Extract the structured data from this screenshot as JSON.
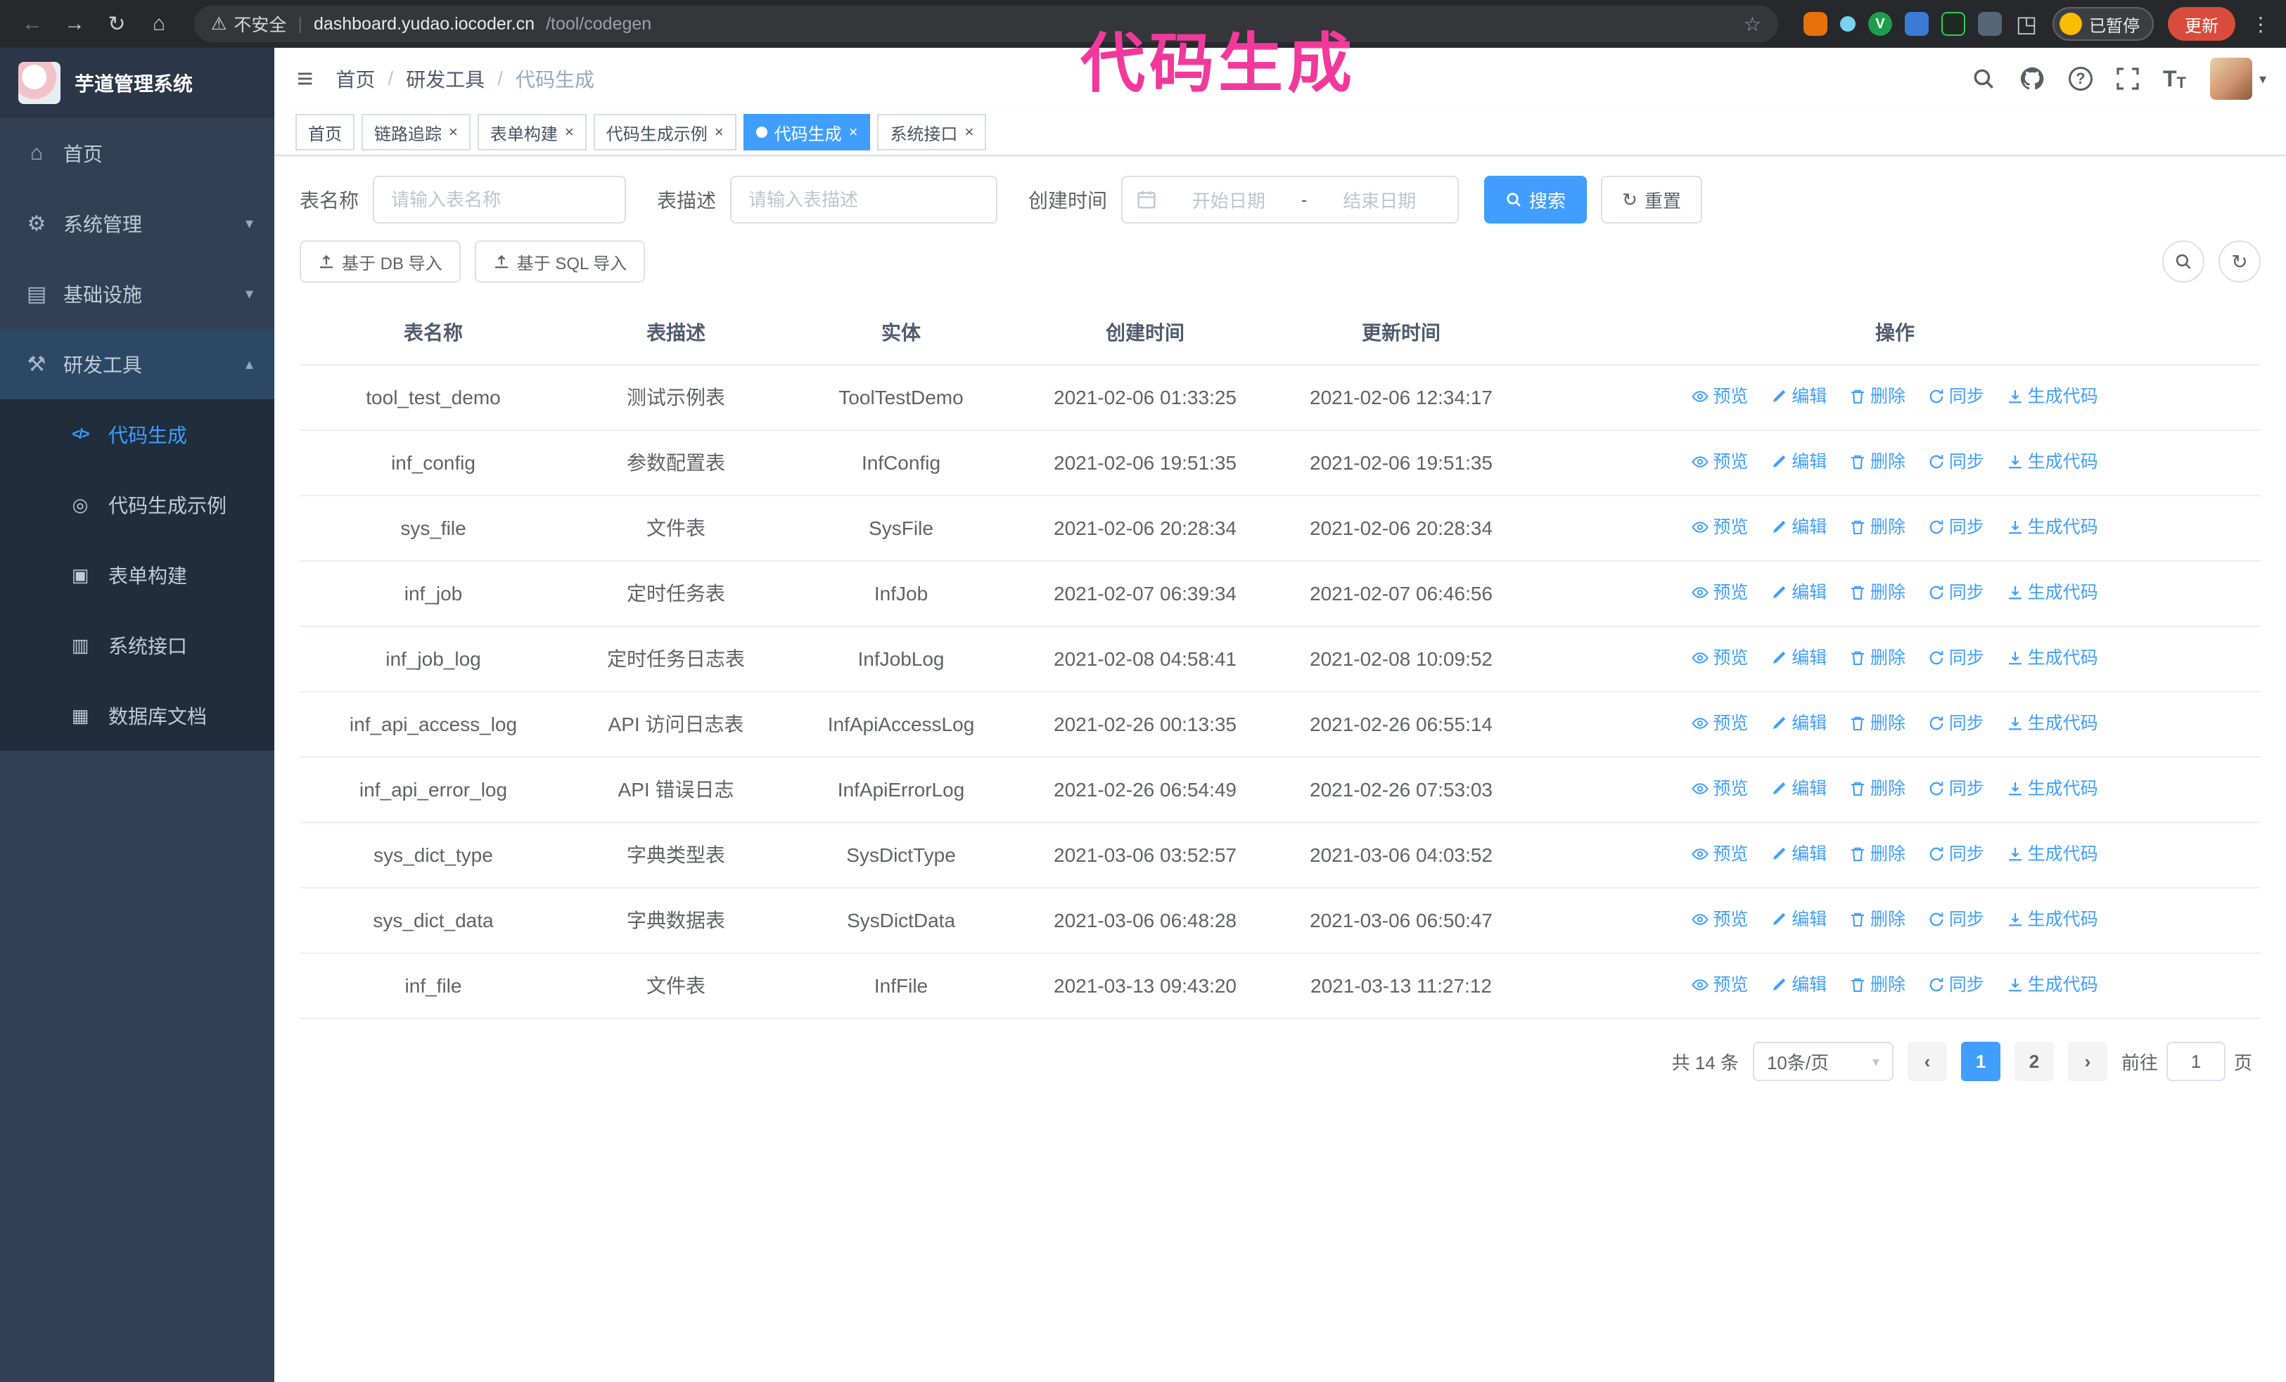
{
  "browser": {
    "security_warning": "不安全",
    "url_domain": "dashboard.yudao.iocoder.cn",
    "url_path": "/tool/codegen",
    "paused_badge": "已暂停",
    "update_button": "更新",
    "ext_v": "V"
  },
  "annotation": {
    "text": "代码生成"
  },
  "app": {
    "title": "芋道管理系统"
  },
  "sidebar": {
    "items": [
      {
        "label": "首页"
      },
      {
        "label": "系统管理"
      },
      {
        "label": "基础设施"
      },
      {
        "label": "研发工具"
      }
    ],
    "sub_items": [
      {
        "label": "代码生成",
        "active": true
      },
      {
        "label": "代码生成示例"
      },
      {
        "label": "表单构建"
      },
      {
        "label": "系统接口"
      },
      {
        "label": "数据库文档"
      }
    ]
  },
  "header": {
    "breadcrumb": [
      "首页",
      "研发工具",
      "代码生成"
    ]
  },
  "tabs": [
    {
      "label": "首页",
      "closable": false
    },
    {
      "label": "链路追踪",
      "closable": true
    },
    {
      "label": "表单构建",
      "closable": true
    },
    {
      "label": "代码生成示例",
      "closable": true
    },
    {
      "label": "代码生成",
      "closable": true,
      "active": true
    },
    {
      "label": "系统接口",
      "closable": true
    }
  ],
  "filters": {
    "table_name_label": "表名称",
    "table_name_placeholder": "请输入表名称",
    "table_desc_label": "表描述",
    "table_desc_placeholder": "请输入表描述",
    "create_time_label": "创建时间",
    "date_start_placeholder": "开始日期",
    "date_separator": "-",
    "date_end_placeholder": "结束日期",
    "search_button": "搜索",
    "reset_button": "重置"
  },
  "toolbar": {
    "import_db": "基于 DB 导入",
    "import_sql": "基于 SQL 导入"
  },
  "table": {
    "columns": [
      "表名称",
      "表描述",
      "实体",
      "创建时间",
      "更新时间",
      "操作"
    ],
    "actions": [
      "预览",
      "编辑",
      "删除",
      "同步",
      "生成代码"
    ],
    "rows": [
      {
        "name": "tool_test_demo",
        "desc": "测试示例表",
        "entity": "ToolTestDemo",
        "created": "2021-02-06 01:33:25",
        "updated": "2021-02-06 12:34:17"
      },
      {
        "name": "inf_config",
        "desc": "参数配置表",
        "entity": "InfConfig",
        "created": "2021-02-06 19:51:35",
        "updated": "2021-02-06 19:51:35"
      },
      {
        "name": "sys_file",
        "desc": "文件表",
        "entity": "SysFile",
        "created": "2021-02-06 20:28:34",
        "updated": "2021-02-06 20:28:34"
      },
      {
        "name": "inf_job",
        "desc": "定时任务表",
        "entity": "InfJob",
        "created": "2021-02-07 06:39:34",
        "updated": "2021-02-07 06:46:56"
      },
      {
        "name": "inf_job_log",
        "desc": "定时任务日志表",
        "entity": "InfJobLog",
        "created": "2021-02-08 04:58:41",
        "updated": "2021-02-08 10:09:52"
      },
      {
        "name": "inf_api_access_log",
        "desc": "API 访问日志表",
        "entity": "InfApiAccessLog",
        "created": "2021-02-26 00:13:35",
        "updated": "2021-02-26 06:55:14"
      },
      {
        "name": "inf_api_error_log",
        "desc": "API 错误日志",
        "entity": "InfApiErrorLog",
        "created": "2021-02-26 06:54:49",
        "updated": "2021-02-26 07:53:03"
      },
      {
        "name": "sys_dict_type",
        "desc": "字典类型表",
        "entity": "SysDictType",
        "created": "2021-03-06 03:52:57",
        "updated": "2021-03-06 04:03:52"
      },
      {
        "name": "sys_dict_data",
        "desc": "字典数据表",
        "entity": "SysDictData",
        "created": "2021-03-06 06:48:28",
        "updated": "2021-03-06 06:50:47"
      },
      {
        "name": "inf_file",
        "desc": "文件表",
        "entity": "InfFile",
        "created": "2021-03-13 09:43:20",
        "updated": "2021-03-13 11:27:12"
      }
    ]
  },
  "pagination": {
    "total": "共 14 条",
    "page_size": "10条/页",
    "pages": [
      "1",
      "2"
    ],
    "active_page": "1",
    "goto_label": "前往",
    "goto_value": "1",
    "goto_suffix": "页"
  },
  "icons": {
    "close": "×",
    "back": "←",
    "forward": "→",
    "reload": "↻",
    "home_nav": "⌂",
    "warning": "⚠",
    "star": "☆",
    "kebab": "⋮",
    "puzzle": "◳",
    "hamburger": "≡",
    "menu_home": "⌂",
    "menu_system": "⚙",
    "menu_infra": "▤",
    "menu_tools": "⚒",
    "chevron_down": "▾",
    "chevron_up": "▴",
    "sub_code": "</>",
    "sub_example": "◎",
    "sub_form": "▣",
    "sub_api": "▥",
    "sub_db": "▦",
    "caret_down": "▾",
    "refresh": "↻",
    "font_large": "T",
    "font_small": "T",
    "help": "?",
    "prev": "‹",
    "next": "›"
  },
  "colors": {
    "primary": "#409eff",
    "sidebar_bg": "#304156",
    "submenu_bg": "#1f2d3d",
    "annotation": "#f2399b",
    "danger": "#d94c3d"
  }
}
